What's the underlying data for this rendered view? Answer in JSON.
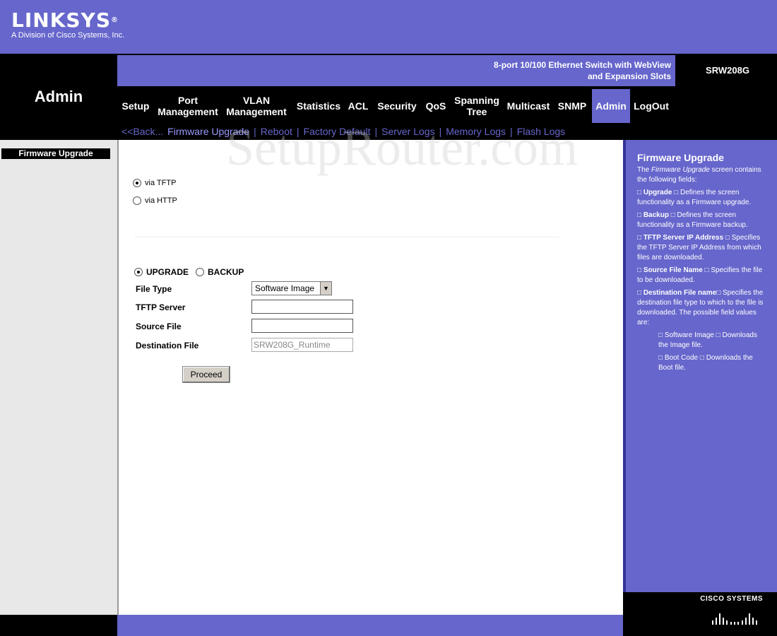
{
  "brand": {
    "name": "LINKSYS",
    "tagline": "A Division of Cisco Systems, Inc."
  },
  "header": {
    "section_title": "Admin",
    "product_line1": "8-port 10/100 Ethernet Switch with WebView",
    "product_line2": "and Expansion Slots",
    "model": "SRW208G"
  },
  "nav": {
    "setup": "Setup",
    "port1": "Port",
    "port2": "Management",
    "vlan1": "VLAN",
    "vlan2": "Management",
    "statistics": "Statistics",
    "acl": "ACL",
    "security": "Security",
    "qos": "QoS",
    "span1": "Spanning",
    "span2": "Tree",
    "multicast": "Multicast",
    "snmp": "SNMP",
    "admin": "Admin",
    "logout": "LogOut"
  },
  "subnav": {
    "back": "<<Back...",
    "firmware": "Firmware Upgrade",
    "sep": "|",
    "reboot": "Reboot",
    "factory": "Factory Default",
    "server_logs": "Server Logs",
    "memory_logs": "Memory Logs",
    "flash_logs": "Flash Logs"
  },
  "sidebar": {
    "item": "Firmware Upgrade"
  },
  "form": {
    "via_tftp": "via TFTP",
    "via_http": "via HTTP",
    "upgrade": "UPGRADE",
    "backup": "BACKUP",
    "file_type_label": "File Type",
    "file_type_value": "Software Image",
    "tftp_server_label": "TFTP Server",
    "tftp_server_value": "",
    "source_file_label": "Source File",
    "source_file_value": "",
    "dest_file_label": "Destination File",
    "dest_file_value": "SRW208G_Runtime",
    "proceed": "Proceed",
    "selected_transport": "via TFTP",
    "selected_operation": "UPGRADE"
  },
  "help": {
    "title": "Firmware Upgrade",
    "intro_a": "The ",
    "intro_em": "Firmware Upgrade",
    "intro_b": " screen contains the following fields:",
    "upgrade_term": "Upgrade",
    "upgrade_desc": " Defines the screen functionality as a Firmware upgrade.",
    "backup_term": "Backup",
    "backup_desc": " Defines the screen functionality as a Firmware backup.",
    "tftp_term": "TFTP Server IP Address",
    "tftp_desc": " Specifies the TFTP Server IP Address from which files are downloaded.",
    "source_term": "Source File Name",
    "source_desc": " Specifies the file to be downloaded.",
    "dest_term": "Destination File name",
    "dest_desc": " Specifies the destination file type to which to the file is downloaded. The possible field values are:",
    "sw_term": "Software Image",
    "sw_desc": " Downloads the Image file.",
    "boot_term": "Boot Code",
    "boot_desc": " Downloads the Boot file.",
    "bullet": "□"
  },
  "footer": {
    "cisco": "CISCO SYSTEMS"
  },
  "watermark": "SetupRouter.com"
}
